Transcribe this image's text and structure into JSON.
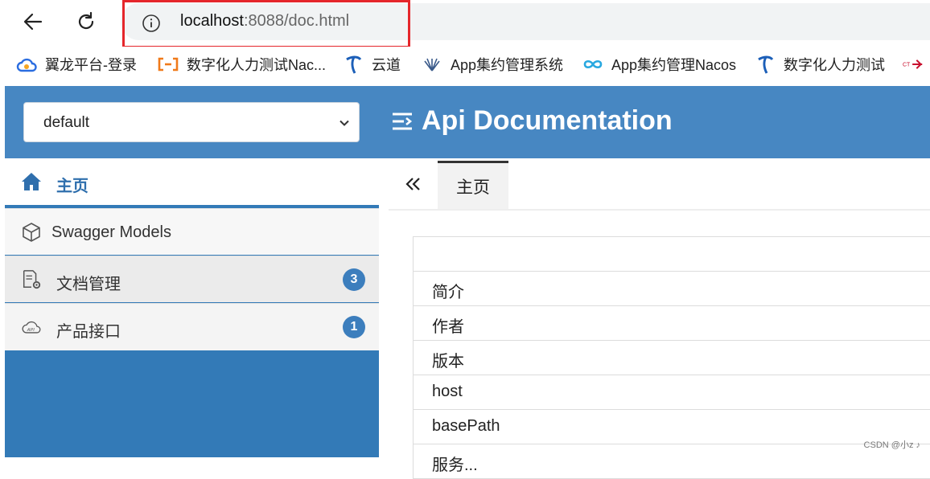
{
  "browser": {
    "url_host": "localhost",
    "url_rest": ":8088/doc.html",
    "bookmarks": [
      {
        "label": "翼龙平台-登录",
        "icon": "cloud-icon",
        "color": "#2b6de0"
      },
      {
        "label": "数字化人力测试Nac...",
        "icon": "bracket-dash-icon",
        "color": "#f07a1a"
      },
      {
        "label": "云道",
        "icon": "telecom-logo-icon",
        "color": "#1c5fb8"
      },
      {
        "label": "App集约管理系统",
        "icon": "leaf-icon",
        "color": "#3a5a8a"
      },
      {
        "label": "App集约管理Nacos",
        "icon": "infinity-icon",
        "color": "#28a8e0"
      },
      {
        "label": "数字化人力测试",
        "icon": "telecom-logo-icon",
        "color": "#1c5fb8"
      },
      {
        "label": "",
        "icon": "china-telecom-icon",
        "color": "#c8102e"
      }
    ]
  },
  "header": {
    "group_value": "default",
    "title": "Api Documentation"
  },
  "sidebar": {
    "items": [
      {
        "label": "主页",
        "icon": "home-icon"
      },
      {
        "label": "Swagger Models",
        "icon": "cube-icon"
      },
      {
        "label": "文档管理",
        "icon": "doc-settings-icon",
        "badge": "3"
      },
      {
        "label": "产品接口",
        "icon": "api-cloud-icon",
        "badge": "1"
      }
    ]
  },
  "tabs": {
    "home_tab": "主页"
  },
  "info_table": {
    "rows": [
      "",
      "简介",
      "作者",
      "版本",
      "host",
      "basePath",
      "服务..."
    ]
  },
  "watermark": "CSDN @小z ♪",
  "colors": {
    "header": "#4787c2",
    "sidebar": "#337ab7",
    "badge": "#3c7ebd",
    "highlight": "#e5262b"
  }
}
